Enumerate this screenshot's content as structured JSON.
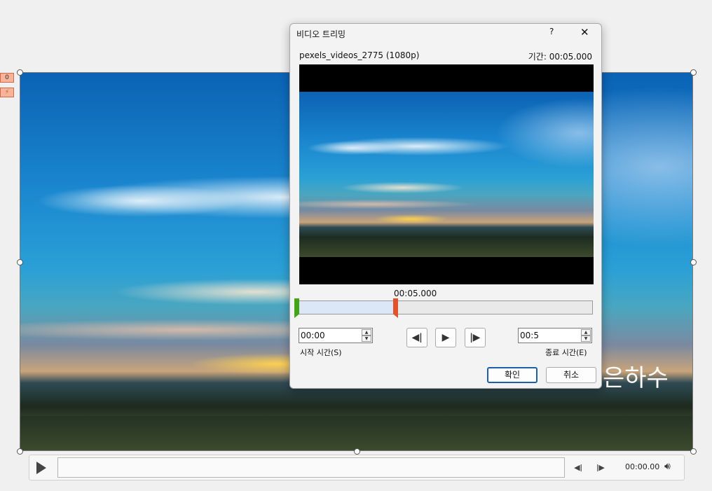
{
  "slide": {
    "overlay_text": "은하수",
    "tags": [
      "0",
      "⚡"
    ]
  },
  "player": {
    "time": "00:00.00",
    "play_icon": "play-icon",
    "prev_icon": "step-back-icon",
    "next_icon": "step-forward-icon",
    "volume_icon": "volume-icon"
  },
  "dialog": {
    "title": "비디오 트리밍",
    "help": "?",
    "close": "✕",
    "file_name": "pexels_videos_2775 (1080p)",
    "duration": "기간: 00:05.000",
    "scrub_time": "00:05.000",
    "start": {
      "value": "00:00",
      "label": "시작 시간(S)"
    },
    "end": {
      "value": "00:5",
      "label": "종료 시간(E)"
    },
    "ok_label": "확인",
    "cancel_label": "취소"
  },
  "colors": {
    "start_marker": "#43a417",
    "end_marker": "#e0532d",
    "primary_border": "#1f5fa8"
  }
}
